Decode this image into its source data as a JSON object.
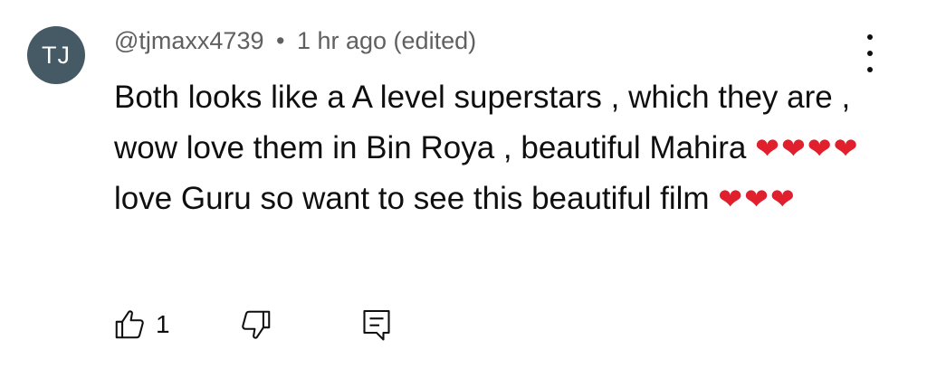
{
  "author": {
    "initials": "TJ",
    "handle": "@tjmaxx4739",
    "separator": "•",
    "timestamp": "1 hr ago (edited)",
    "avatar_color": "#455a64"
  },
  "comment": {
    "text_part1": "Both looks like a A level superstars , which they are , wow love them in Bin Roya , beautiful Mahira ",
    "hearts_1": "❤❤❤❤",
    "text_part2": "love Guru so want to see this beautiful film ",
    "hearts_2": "❤❤❤",
    "heart_color": "#e0202d"
  },
  "actions": {
    "like_icon": "thumbs-up-icon",
    "like_count": "1",
    "dislike_icon": "thumbs-down-icon",
    "reply_icon": "reply-comment-icon",
    "menu_icon": "more-vertical-icon"
  }
}
